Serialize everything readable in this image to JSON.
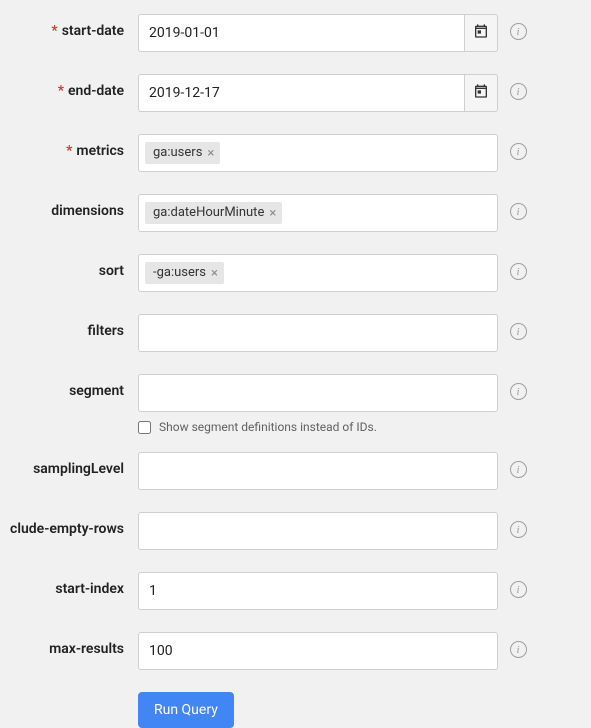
{
  "fields": {
    "startDate": {
      "label": "start-date",
      "required": true,
      "value": "2019-01-01"
    },
    "endDate": {
      "label": "end-date",
      "required": true,
      "value": "2019-12-17"
    },
    "metrics": {
      "label": "metrics",
      "required": true,
      "tags": [
        "ga:users"
      ]
    },
    "dimensions": {
      "label": "dimensions",
      "required": false,
      "tags": [
        "ga:dateHourMinute"
      ]
    },
    "sort": {
      "label": "sort",
      "required": false,
      "tags": [
        "-ga:users"
      ]
    },
    "filters": {
      "label": "filters",
      "required": false,
      "value": ""
    },
    "segment": {
      "label": "segment",
      "required": false,
      "value": ""
    },
    "segmentCheckbox": {
      "label": "Show segment definitions instead of IDs.",
      "checked": false
    },
    "samplingLevel": {
      "label": "samplingLevel",
      "required": false,
      "value": ""
    },
    "includeEmptyRows": {
      "label": "clude-empty-rows",
      "required": false,
      "value": ""
    },
    "startIndex": {
      "label": "start-index",
      "required": false,
      "value": "1"
    },
    "maxResults": {
      "label": "max-results",
      "required": false,
      "value": "100"
    }
  },
  "submit": {
    "label": "Run Query"
  }
}
